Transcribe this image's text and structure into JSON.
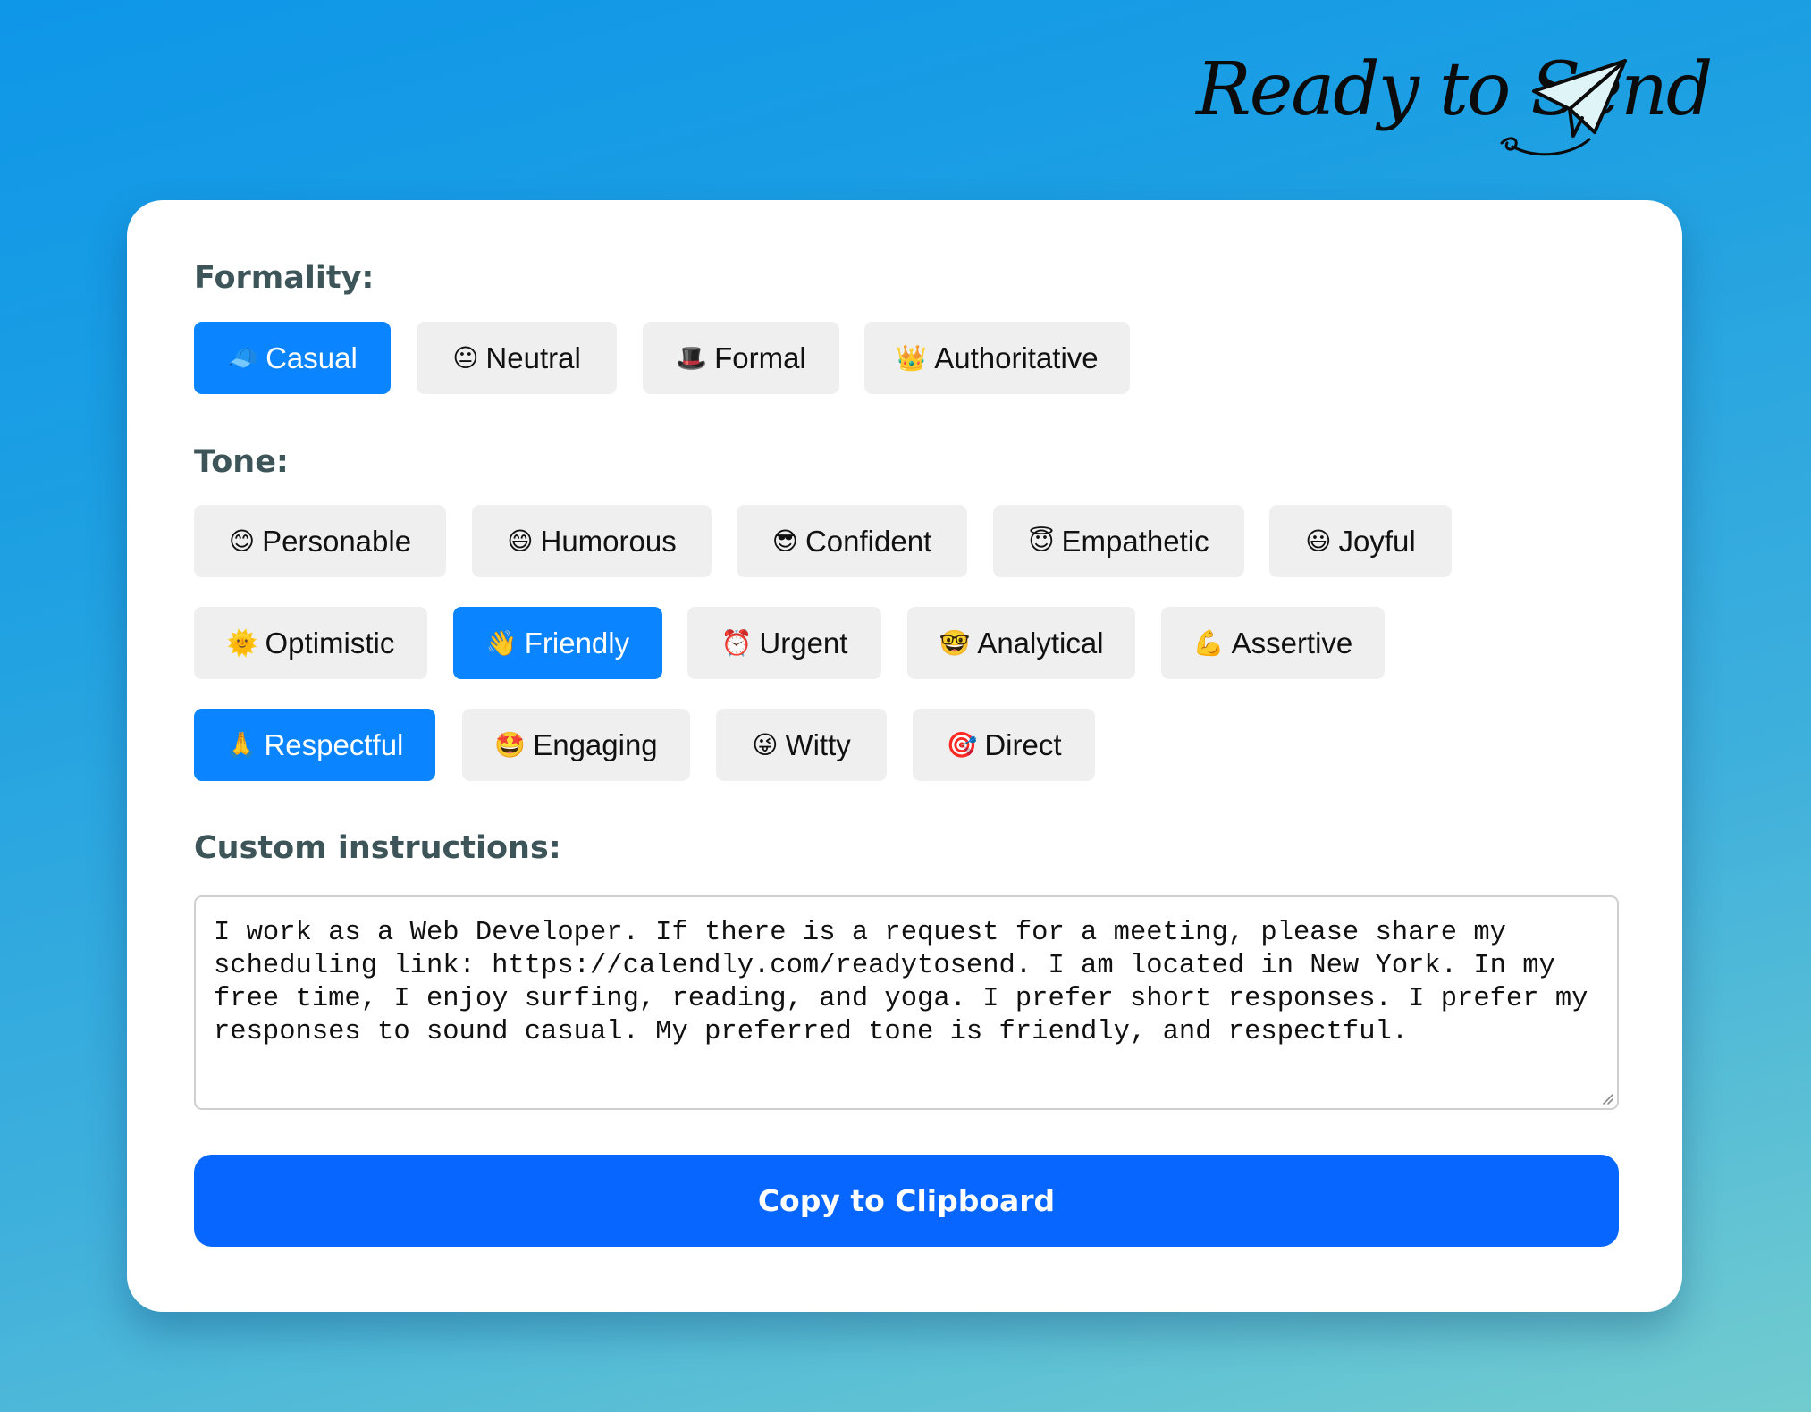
{
  "logo": {
    "text": "Ready to Send"
  },
  "formality": {
    "label": "Formality:",
    "options": [
      {
        "emoji": "🧢",
        "label": "Casual",
        "selected": true
      },
      {
        "emoji": "😐",
        "label": "Neutral",
        "selected": false
      },
      {
        "emoji": "🎩",
        "label": "Formal",
        "selected": false
      },
      {
        "emoji": "👑",
        "label": "Authoritative",
        "selected": false
      }
    ]
  },
  "tone": {
    "label": "Tone:",
    "options": [
      {
        "emoji": "😊",
        "label": "Personable",
        "selected": false
      },
      {
        "emoji": "😄",
        "label": "Humorous",
        "selected": false
      },
      {
        "emoji": "😎",
        "label": "Confident",
        "selected": false
      },
      {
        "emoji": "😇",
        "label": "Empathetic",
        "selected": false
      },
      {
        "emoji": "😃",
        "label": "Joyful",
        "selected": false
      },
      {
        "emoji": "🌞",
        "label": "Optimistic",
        "selected": false
      },
      {
        "emoji": "👋",
        "label": "Friendly",
        "selected": true
      },
      {
        "emoji": "⏰",
        "label": "Urgent",
        "selected": false
      },
      {
        "emoji": "🤓",
        "label": "Analytical",
        "selected": false
      },
      {
        "emoji": "💪",
        "label": "Assertive",
        "selected": false
      },
      {
        "emoji": "🙏",
        "label": "Respectful",
        "selected": true
      },
      {
        "emoji": "🤩",
        "label": "Engaging",
        "selected": false
      },
      {
        "emoji": "😜",
        "label": "Witty",
        "selected": false
      },
      {
        "emoji": "🎯",
        "label": "Direct",
        "selected": false
      }
    ]
  },
  "custom": {
    "label": "Custom instructions:",
    "value": "I work as a Web Developer. If there is a request for a meeting, please share my scheduling link: https://calendly.com/readytosend. I am located in New York. In my free time, I enjoy surfing, reading, and yoga. I prefer short responses. I prefer my responses to sound casual. My preferred tone is friendly, and respectful."
  },
  "actions": {
    "copy_label": "Copy to Clipboard"
  },
  "colors": {
    "selected_chip": "#0a84ff",
    "unselected_chip": "#efefef",
    "primary_button": "#0666ff",
    "label_text": "#3d5558"
  }
}
